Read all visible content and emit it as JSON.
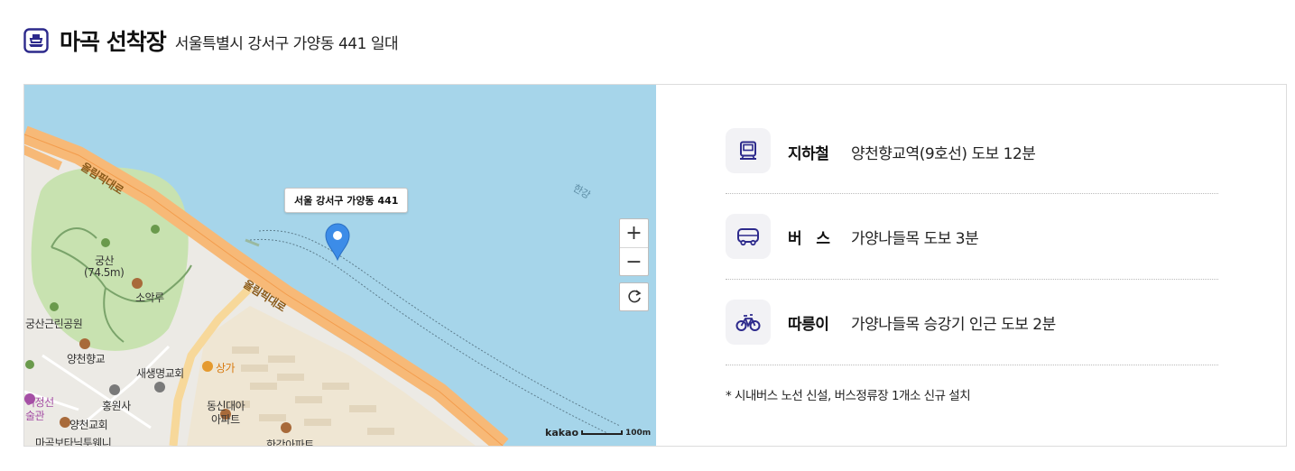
{
  "header": {
    "title": "마곡 선착장",
    "address": "서울특별시 강서구 가양동 441 일대",
    "icon": "ferry-icon"
  },
  "map": {
    "tooltip": "서울 강서구 가양동 441",
    "attribution": "kakao",
    "scale": "100m",
    "zoom_in": "+",
    "zoom_out": "−",
    "labels": {
      "road1": "올림픽대로",
      "road2": "올림픽대로",
      "river": "한강",
      "mountain": "궁산",
      "elevation": "(74.5m)",
      "soak": "소악루",
      "park": "궁산근린공원",
      "school": "양천향교",
      "church1": "새생명교회",
      "market": "상가",
      "temple": "홍원사",
      "museum_a": "허정선",
      "museum_b": "술관",
      "apt_a": "동신대아",
      "apt_b": "아파트",
      "church2": "양천교회",
      "botanic": "마곡보타닉투웨니",
      "hangang_apt": "한강아파트"
    }
  },
  "transport": [
    {
      "icon": "subway-icon",
      "label": "지하철",
      "text": "양천향교역(9호선) 도보 12분"
    },
    {
      "icon": "bus-icon",
      "label": "버   스",
      "text": "가양나들목 도보 3분"
    },
    {
      "icon": "bike-icon",
      "label": "따릉이",
      "text": "가양나들목 승강기 인근 도보 2분"
    }
  ],
  "note": "* 시내버스 노선 신설, 버스정류장 1개소 신규 설치",
  "colors": {
    "accent": "#2d2a8c",
    "water": "#a6d5ea",
    "road": "#f7b977",
    "park": "#c8e2b0",
    "pin": "#3c8ce8"
  }
}
